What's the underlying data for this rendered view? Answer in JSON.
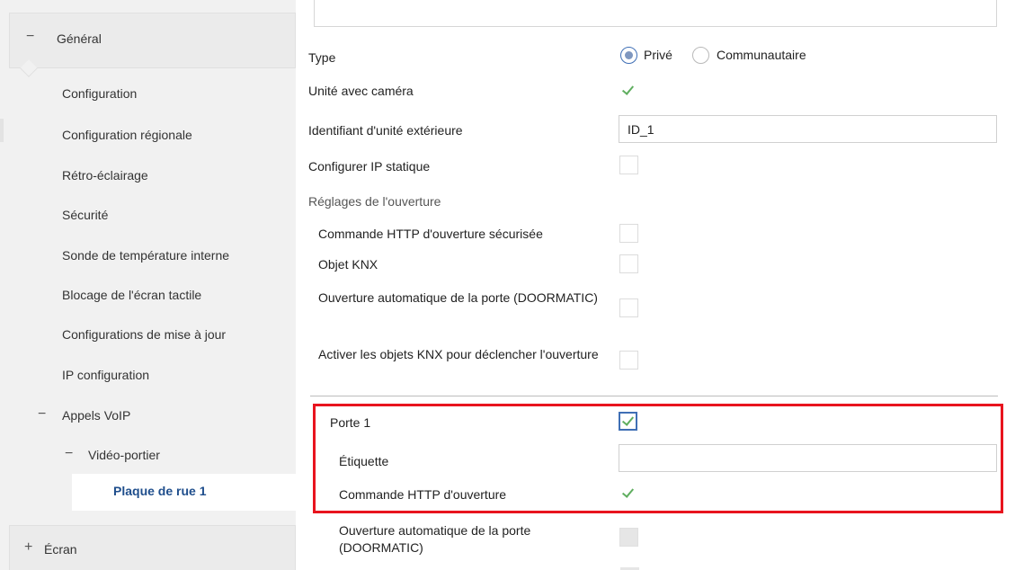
{
  "sidebar": {
    "general": {
      "toggle": "−",
      "label": "Général"
    },
    "items": [
      {
        "label": "Configuration"
      },
      {
        "label": "Configuration régionale"
      },
      {
        "label": "Rétro-éclairage"
      },
      {
        "label": "Sécurité"
      },
      {
        "label": "Sonde de température interne"
      },
      {
        "label": "Blocage de l'écran tactile"
      },
      {
        "label": "Configurations de mise à jour"
      },
      {
        "label": "IP configuration"
      }
    ],
    "voip": {
      "toggle": "−",
      "label": "Appels VoIP"
    },
    "video": {
      "toggle": "−",
      "label": "Vidéo-portier"
    },
    "selected": {
      "label": "Plaque de rue 1"
    },
    "ecran": {
      "toggle": "+",
      "label": "Écran"
    }
  },
  "form": {
    "type": {
      "label": "Type",
      "options": [
        "Privé",
        "Communautaire"
      ],
      "selected": "Privé"
    },
    "camera": {
      "label": "Unité avec caméra",
      "checked": true
    },
    "outdoor_id": {
      "label": "Identifiant d'unité extérieure",
      "value": "ID_1"
    },
    "static_ip": {
      "label": "Configurer IP statique",
      "checked": false
    },
    "opening_section": {
      "label": "Réglages de l'ouverture"
    },
    "secure_http": {
      "label": "Commande HTTP d'ouverture sécurisée",
      "checked": false
    },
    "knx_object": {
      "label": "Objet KNX",
      "checked": false
    },
    "doormatic": {
      "label": "Ouverture automatique de la porte (DOORMATIC)",
      "checked": false
    },
    "knx_trigger": {
      "label": "Activer les objets KNX pour déclencher l'ouverture",
      "checked": false
    },
    "porte1": {
      "label": "Porte 1",
      "checked": true
    },
    "etiquette": {
      "label": "Étiquette",
      "value": ""
    },
    "http_open": {
      "label": "Commande HTTP d'ouverture",
      "checked": true
    },
    "doormatic2": {
      "label": "Ouverture automatique de la porte (DOORMATIC)",
      "checked": false,
      "disabled": true
    }
  },
  "colors": {
    "accent": "#1f4e8c",
    "highlight": "#e8141e",
    "check": "#5fae5f"
  }
}
